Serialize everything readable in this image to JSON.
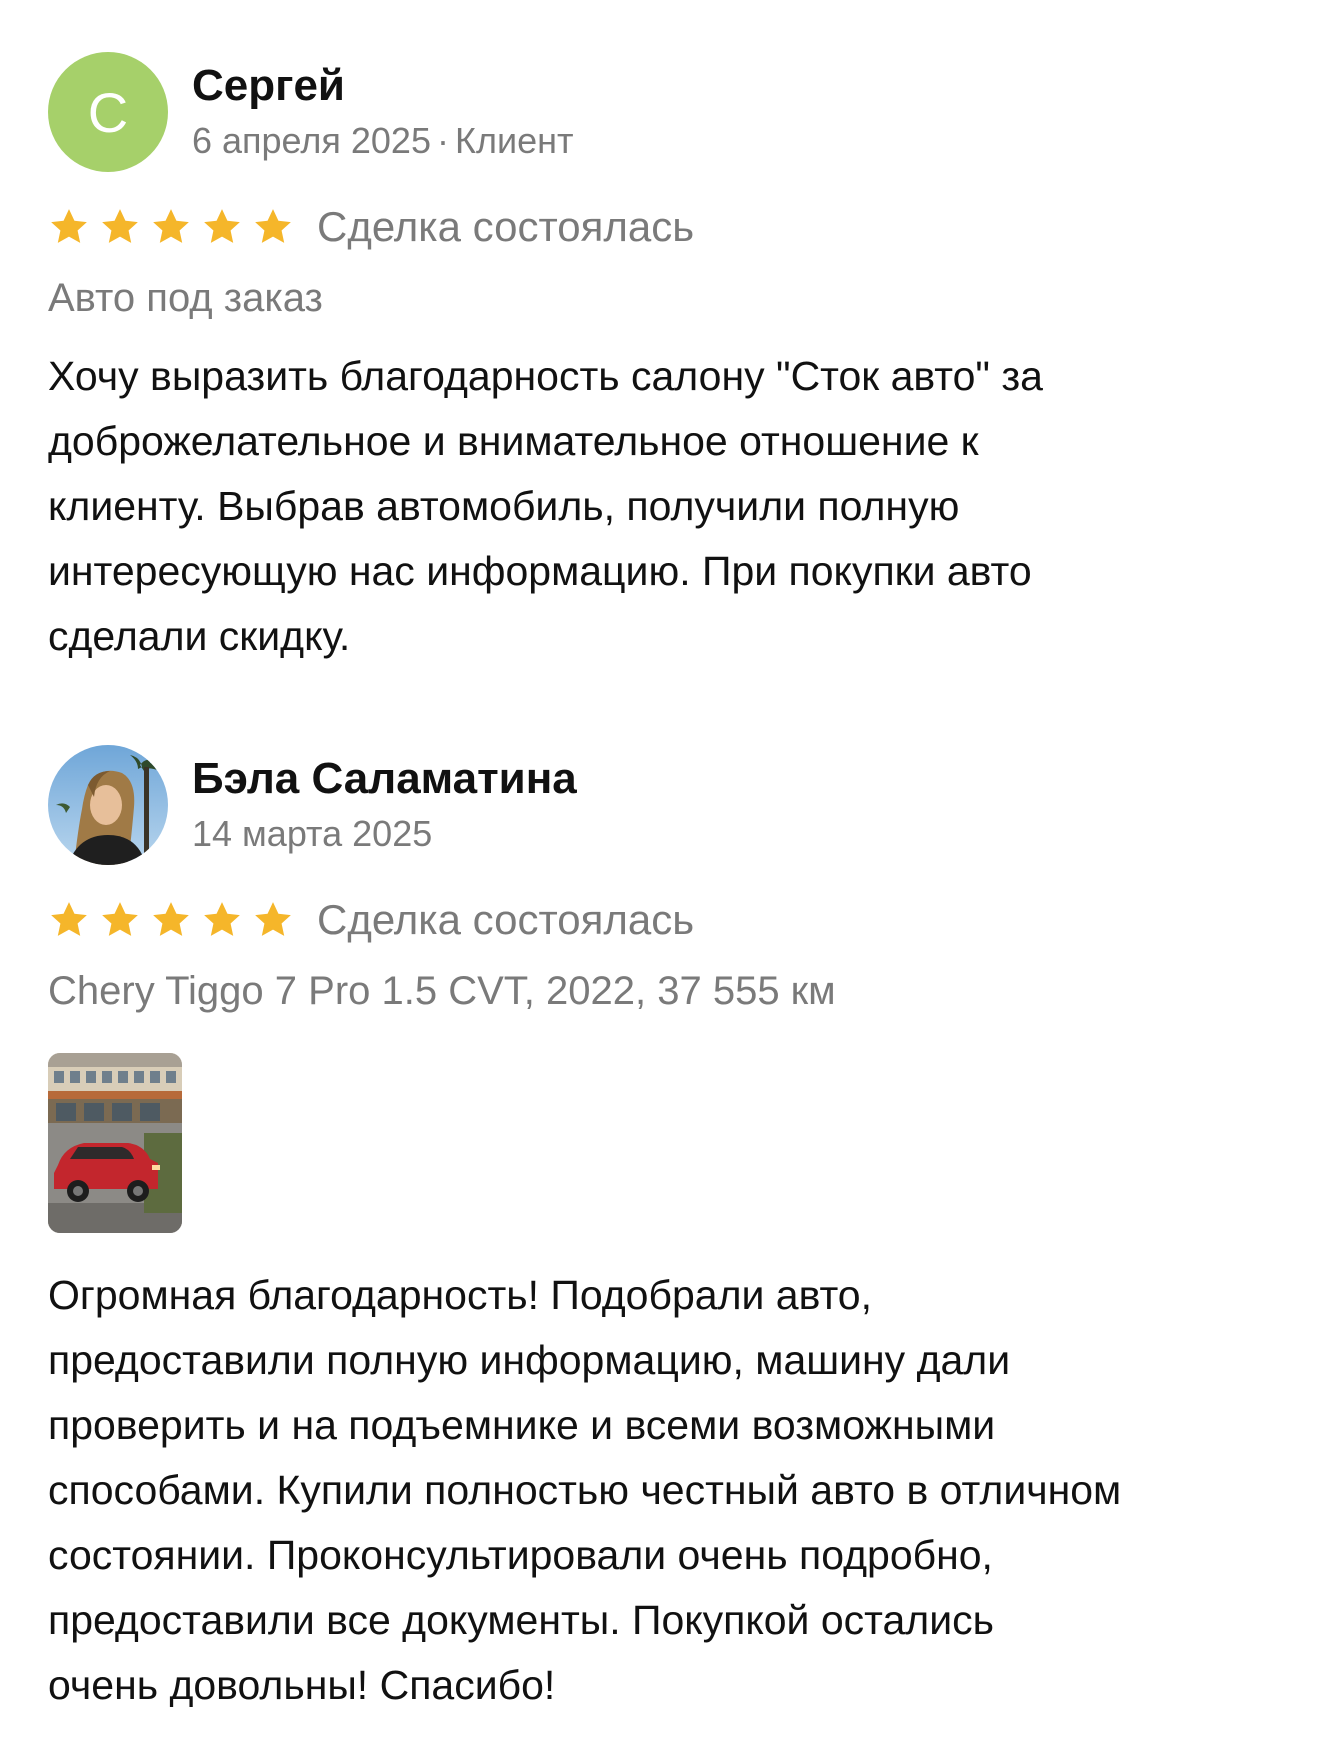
{
  "reviews": [
    {
      "author": "Сергей",
      "avatar_letter": "С",
      "avatar_color": "#a6d06a",
      "date": "6 апреля 2025",
      "separator": "·",
      "role": "Клиент",
      "rating": 5,
      "status": "Сделка состоялась",
      "subject": "Авто под заказ",
      "text": "Хочу выразить благодарность салону \"Сток авто\" за\nдоброжелательное и  внимательное отношение  к\nклиенту. Выбрав  автомобиль, получили полную\nинтересующую нас информацию. При покупки авто\nсделали скидку."
    },
    {
      "author": "Бэла Саламатина",
      "avatar_icon": "user-photo",
      "date": "14 марта 2025",
      "rating": 5,
      "status": "Сделка состоялась",
      "subject": "Chery Tiggo 7 Pro 1.5 CVT, 2022, 37 555 км",
      "photo_icon": "red-car-photo",
      "text": "Огромная благодарность! Подобрали авто,\nпредоставили полную информацию, машину дали\nпроверить и на подъемнике и всеми возможными\nспособами. Купили полностью честный авто в отличном\nсостоянии. Проконсультировали очень подробно,\nпредоставили все документы. Покупкой остались\nочень довольны! Спасибо!"
    }
  ],
  "colors": {
    "star": "#f5b62a",
    "muted_text": "#7a7a7a",
    "text": "#111111"
  }
}
